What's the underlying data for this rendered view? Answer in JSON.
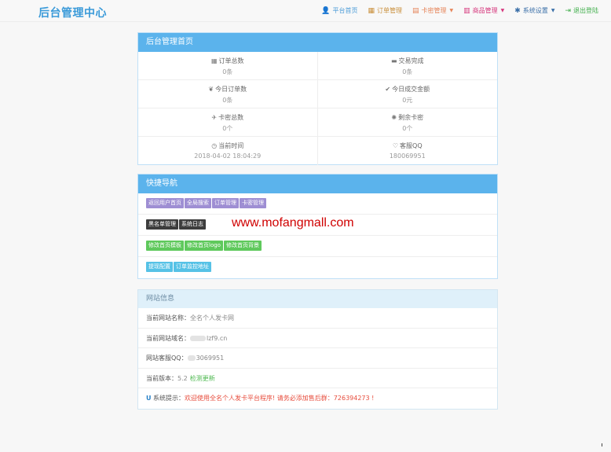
{
  "header": {
    "brand": "后台管理中心",
    "nav": [
      {
        "icon": "user-icon",
        "glyph": "👤",
        "label": "平台首页",
        "color": "#4d9dd8",
        "caret": false
      },
      {
        "icon": "list-icon",
        "glyph": "▦",
        "label": "订单管理",
        "color": "#c98f3b",
        "caret": false
      },
      {
        "icon": "card-icon",
        "glyph": "▤",
        "label": "卡密管理",
        "color": "#e6855a",
        "caret": true
      },
      {
        "icon": "product-icon",
        "glyph": "▥",
        "label": "商品管理",
        "color": "#d6377d",
        "caret": true
      },
      {
        "icon": "gear-icon",
        "glyph": "✱",
        "label": "系统设置",
        "color": "#3a6fa8",
        "caret": true
      },
      {
        "icon": "logout-icon",
        "glyph": "⇥",
        "label": "退出登陆",
        "color": "#3fae4a",
        "caret": false
      }
    ]
  },
  "home": {
    "title": "后台管理首页",
    "stats": [
      {
        "icon": "grid-icon",
        "glyph": "▦",
        "label": "订单总数",
        "value": "0条"
      },
      {
        "icon": "cart-icon",
        "glyph": "▬",
        "label": "交易完成",
        "value": "0条"
      },
      {
        "icon": "leaf-icon",
        "glyph": "❦",
        "label": "今日订单数",
        "value": "0条"
      },
      {
        "icon": "check-icon",
        "glyph": "✔",
        "label": "今日成交金额",
        "value": "0元"
      },
      {
        "icon": "plane-icon",
        "glyph": "✈",
        "label": "卡密总数",
        "value": "0个"
      },
      {
        "icon": "asterisk-icon",
        "glyph": "✺",
        "label": "剩余卡密",
        "value": "0个"
      },
      {
        "icon": "clock-icon",
        "glyph": "◷",
        "label": "当前时间",
        "value": "2018-04-02 18:04:29"
      },
      {
        "icon": "heart-icon",
        "glyph": "♡",
        "label": "客服QQ",
        "value": "180069951"
      }
    ]
  },
  "quicknav": {
    "title": "快捷导航",
    "rows": [
      {
        "style": "purple",
        "buttons": [
          "返回用户首页",
          "全局搜索",
          "订单管理",
          "卡密管理"
        ]
      },
      {
        "style": "dark",
        "buttons": [
          "黑名单管理",
          "系统日志"
        ]
      },
      {
        "style": "green",
        "buttons": [
          "修改首页模板",
          "修改首页logo",
          "修改首页背景"
        ]
      },
      {
        "style": "cyan",
        "buttons": [
          "提现配置",
          "订单监控地址"
        ]
      }
    ],
    "watermark": "www.mofangmall.com"
  },
  "siteinfo": {
    "title": "网站信息",
    "site_name_label": "当前网站名称：",
    "site_name": "全名个人发卡网",
    "domain_label": "当前网站域名：",
    "domain": "lzf9.cn",
    "qq_label": "网站客服QQ：",
    "qq": "3069951",
    "version_label": "当前版本：",
    "version": "5.2",
    "update_link": "检测更新",
    "tip_label": "系统提示：",
    "tip": "欢迎使用全名个人发卡平台程序! 请务必添加售后群：726394273 !"
  },
  "colors": {
    "primary": "#5bb3ec",
    "brand": "#3a9ad9",
    "danger": "#e74c3c",
    "success": "#4db84f"
  }
}
